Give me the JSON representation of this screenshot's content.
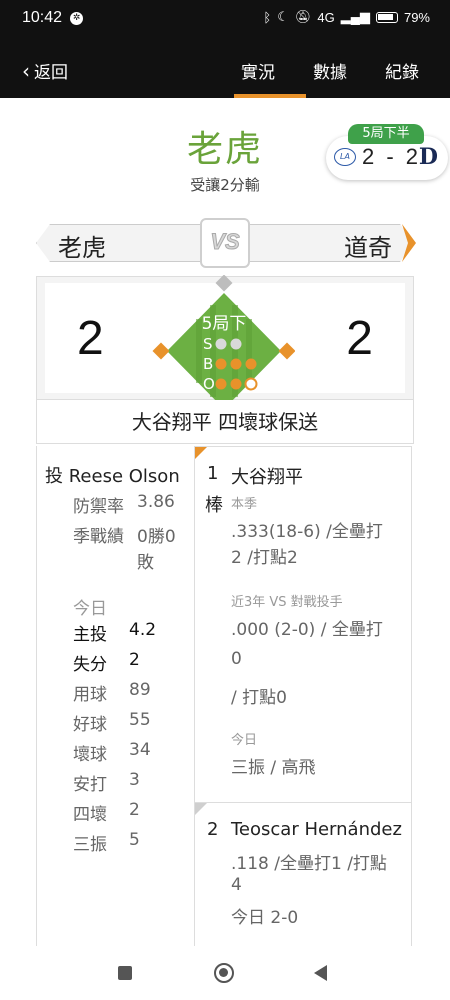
{
  "status_bar": {
    "time": "10:42",
    "battery": "79%",
    "indicators": "4G"
  },
  "nav": {
    "back_label": "返回",
    "tabs": [
      {
        "label": "實況",
        "active": true
      },
      {
        "label": "數據",
        "active": false
      },
      {
        "label": "紀錄",
        "active": false
      }
    ],
    "accent": "#e8922b"
  },
  "header": {
    "team_title": "老虎",
    "subtitle": "受讓2分輸",
    "score_card": {
      "inning": "5局下半",
      "away_logo": "Dodgers",
      "score": "2 - 2",
      "home_logo": "D"
    }
  },
  "matchup": {
    "left_team": "老虎",
    "right_team": "道奇",
    "vs": "VS"
  },
  "scoreboard": {
    "left_score": "2",
    "right_score": "2",
    "inning": "5局下",
    "count": {
      "balls": 3,
      "strikes": 0,
      "outs": 2
    },
    "labels": {
      "s": "S",
      "b": "B",
      "o": "O"
    }
  },
  "play_description": "大谷翔平 四壞球保送",
  "pitcher": {
    "role": "投",
    "name": "Reese Olson",
    "era_label": "防禦率",
    "era": "3.86",
    "record_label": "季戰績",
    "record_line1": "0勝0",
    "record_line2": "敗",
    "today_label": "今日",
    "stats": [
      {
        "k": "主投",
        "v": "4.2"
      },
      {
        "k": "失分",
        "v": "2"
      },
      {
        "k": "用球",
        "v": "89"
      },
      {
        "k": "好球",
        "v": "55"
      },
      {
        "k": "壞球",
        "v": "34"
      },
      {
        "k": "安打",
        "v": "3"
      },
      {
        "k": "四壞",
        "v": "2"
      },
      {
        "k": "三振",
        "v": "5"
      }
    ]
  },
  "batters": [
    {
      "order": "1",
      "order_suffix": "棒",
      "name": "大谷翔平",
      "season_label": "本季",
      "season_line1": ".333(18-6) /全壘打",
      "season_line2": "2 /打點2",
      "vs_label": "近3年 VS 對戰投手",
      "vs_line1": ".000 (2-0) / 全壘打",
      "vs_line2": "0",
      "vs_line3": "/ 打點0",
      "today_label": "今日",
      "today_line": "三振 / 高飛"
    },
    {
      "order": "2",
      "name": "Teoscar Hernández",
      "line1": ".118 /全壘打1 /打點",
      "line2": "4",
      "line3": "今日 2-0"
    }
  ],
  "colors": {
    "field_green": "#6cb043",
    "ball_orange": "#e8922b",
    "team_green": "#6aa33a",
    "pill_green": "#3fa14a"
  }
}
